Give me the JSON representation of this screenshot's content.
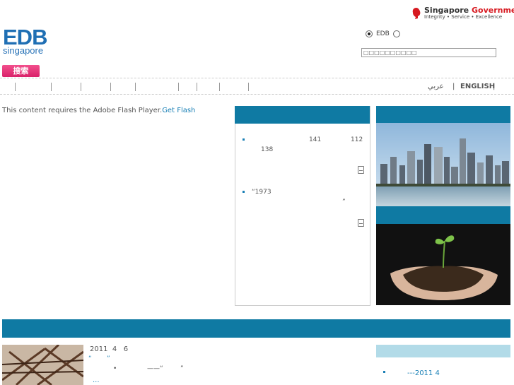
{
  "header": {
    "gov_logo": {
      "name": "Singapore",
      "name_red": "Government",
      "tagline": "Integrity • Service • Excellence"
    },
    "edb_logo": {
      "big": "EDB",
      "small": "singapore"
    },
    "search": {
      "scope_options": [
        {
          "label": "EDB",
          "selected": true
        },
        {
          "label": "",
          "selected": false
        }
      ],
      "input_value": "□□□□□□□□□□",
      "button_label": "搜索"
    },
    "languages": {
      "arabic": "عربي",
      "separator": "|",
      "english": "ENGLISH",
      "trailing": "|"
    }
  },
  "main": {
    "flash": {
      "message": "This content requires the Adobe Flash Player.",
      "link": "Get Flash"
    },
    "news": [
      {
        "line1_a": "141",
        "line1_b": "112",
        "line2": "138"
      },
      {
        "line1": "“1973",
        "line2": "”"
      }
    ],
    "bottom": {
      "date_year": "2011",
      "date_month": "4",
      "date_day": "6",
      "quote_open": "“",
      "quote_close": "”",
      "dot": "•",
      "dash": "——“",
      "quote_close2": "”",
      "more": "...",
      "publication": "---2011 4"
    }
  },
  "colors": {
    "accent": "#0f7aa3",
    "link": "#1a80b6",
    "search_button": "#e2306f",
    "brand_red": "#d71920"
  },
  "icons": [
    "singapore-lion-icon",
    "radio-selected-icon",
    "radio-icon",
    "bullet-icon",
    "document-icon"
  ]
}
